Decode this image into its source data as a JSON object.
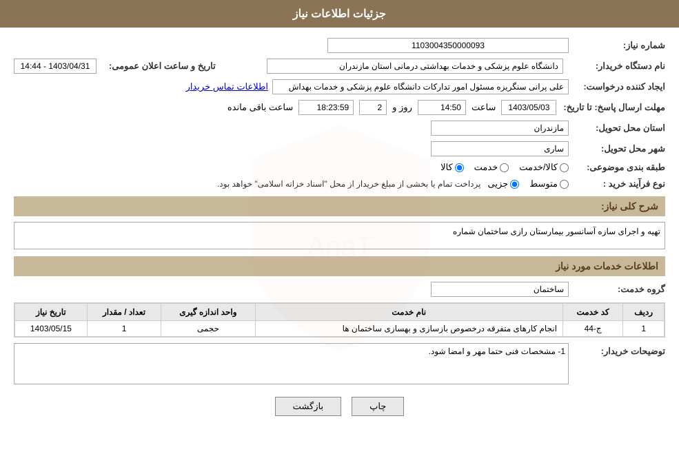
{
  "header": {
    "title": "جزئیات اطلاعات نیاز"
  },
  "fields": {
    "need_number_label": "شماره نیاز:",
    "need_number_value": "1103004350000093",
    "buyer_org_label": "نام دستگاه خریدار:",
    "buyer_org_value": "دانشگاه علوم پزشکی و خدمات بهداشتی  درمانی استان مازندران",
    "announce_date_label": "تاریخ و ساعت اعلان عمومی:",
    "announce_date_value": "1403/04/31 - 14:44",
    "creator_label": "ایجاد کننده درخواست:",
    "creator_value": "علی پرانی سنگریزه مسئول امور تدارکات دانشگاه علوم پزشکی و خدمات بهداش",
    "contact_link": "اطلاعات تماس خریدار",
    "reply_deadline_label": "مهلت ارسال پاسخ: تا تاریخ:",
    "reply_date": "1403/05/03",
    "reply_time": "14:50",
    "reply_days": "2",
    "reply_remaining": "18:23:59",
    "reply_remaining_label": "ساعت باقی مانده",
    "reply_days_label": "روز و",
    "reply_time_label": "ساعت",
    "province_label": "استان محل تحویل:",
    "province_value": "مازندران",
    "city_label": "شهر محل تحویل:",
    "city_value": "ساری",
    "category_label": "طبقه بندی موضوعی:",
    "category_kala": "کالا",
    "category_khadamat": "خدمت",
    "category_kala_khadamat": "کالا/خدمت",
    "process_label": "نوع فرآیند خرید :",
    "process_jozi": "جزیی",
    "process_motovaset": "متوسط",
    "process_desc": "پرداخت تمام یا بخشی از مبلغ خریدار از محل \"اسناد خزانه اسلامی\" خواهد بود.",
    "general_desc_label": "شرح کلی نیاز:",
    "general_desc_value": "تهیه و اجرای سازه آسانسور بیمارستان رازی ساختمان شماره",
    "services_section": "اطلاعات خدمات مورد نیاز",
    "service_group_label": "گروه خدمت:",
    "service_group_value": "ساختمان",
    "table": {
      "headers": [
        "ردیف",
        "کد خدمت",
        "نام خدمت",
        "واحد اندازه گیری",
        "تعداد / مقدار",
        "تاریخ نیاز"
      ],
      "rows": [
        {
          "row": "1",
          "code": "ج-44",
          "name": "انجام کارهای متفرقه درخصوص بازسازی و بهسازی ساختمان ها",
          "unit": "حجمی",
          "quantity": "1",
          "date": "1403/05/15"
        }
      ]
    },
    "buyer_notes_label": "توضیحات خریدار:",
    "buyer_notes_value": "1- مشخصات فنی حتما مهر و امضا شود."
  },
  "buttons": {
    "print": "چاپ",
    "back": "بازگشت"
  }
}
